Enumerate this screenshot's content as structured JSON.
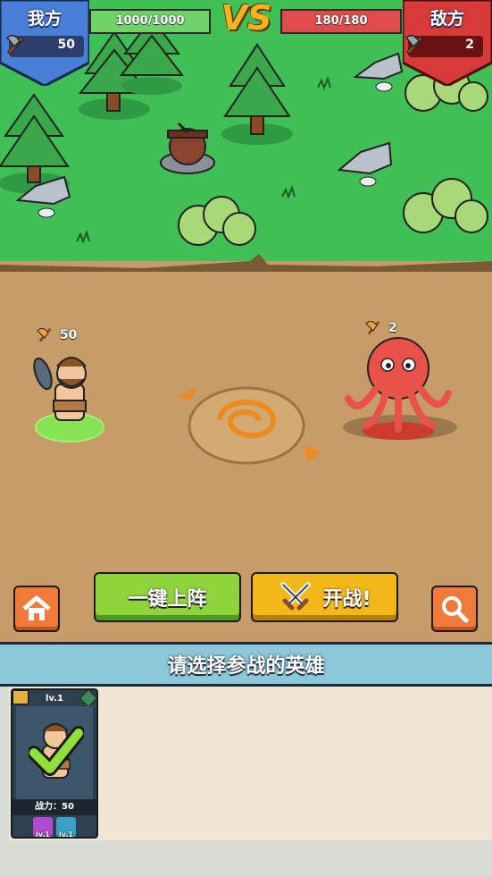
{
  "hud": {
    "my_side": {
      "label": "我方",
      "power": "50",
      "hp": "1000/1000",
      "color": "#4a7fd9"
    },
    "vs": "VS",
    "enemy_side": {
      "label": "敌方",
      "power": "2",
      "hp": "180/180",
      "color": "#d83a3a"
    }
  },
  "battlefield": {
    "my_unit": {
      "name": "caveman",
      "power": "50"
    },
    "enemy_unit": {
      "name": "octopus",
      "power": "2"
    }
  },
  "controls": {
    "home_icon": "home-icon",
    "auto_deploy": "一键上阵",
    "start_battle": "开战!",
    "search_icon": "search-icon"
  },
  "hero_select": {
    "title": "请选择参战的英雄",
    "heroes": [
      {
        "level": "lv.1",
        "power_label": "战力：50",
        "selected": true,
        "skills": [
          {
            "level": "lv.1",
            "color": "#b04ad0"
          },
          {
            "level": "lv.1",
            "color": "#3aa0c8"
          }
        ]
      }
    ]
  },
  "colors": {
    "grass": "#3fbf55",
    "dirt": "#c89c68",
    "accent_green": "#8fd43c",
    "accent_yellow": "#f3b818",
    "accent_orange": "#f07a3a"
  }
}
